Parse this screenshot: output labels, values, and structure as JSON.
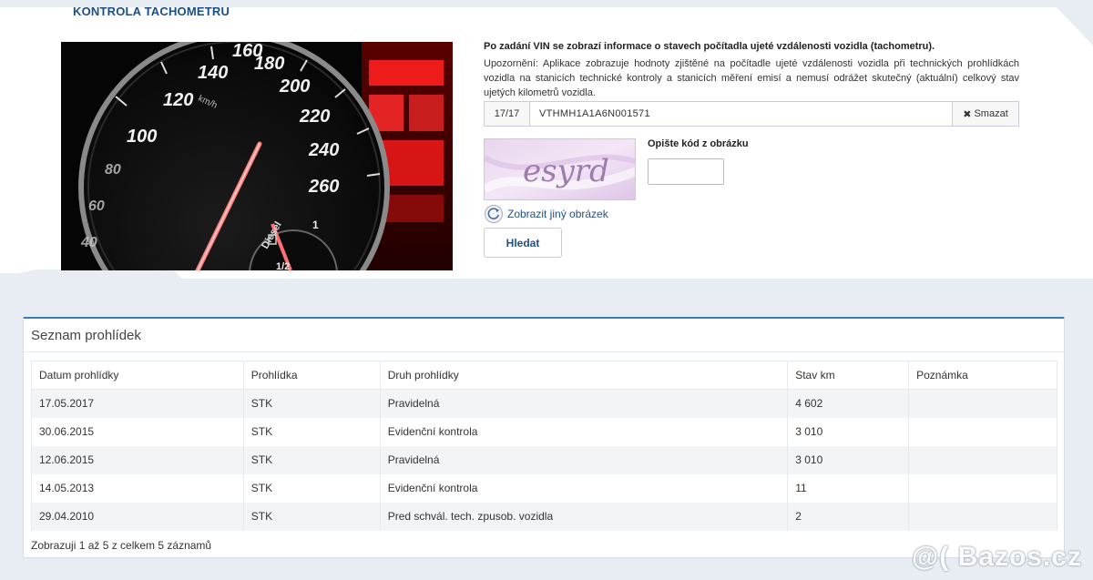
{
  "header": {
    "title": "KONTROLA TACHOMETRU"
  },
  "hero": {
    "speed_labels": [
      "100",
      "120",
      "140",
      "160",
      "180",
      "200",
      "220",
      "240",
      "260"
    ],
    "low_labels": [
      "80",
      "60",
      "40"
    ],
    "unit": "km/h",
    "fuel_label": "Diesel",
    "fuel_marks": [
      "1",
      "1/2"
    ]
  },
  "info": {
    "heading": "Po zadání VIN se zobrazí informace o stavech počítadla ujeté vzdálenosti vozidla (tachometru).",
    "warning": "Upozornění: Aplikace zobrazuje hodnoty zjištěné na počítadle ujeté vzdálenosti vozidla při technických prohlídkách vozidla na stanicích technické kontroly a stanicích měření emisí a nemusí odrážet skutečný (aktuální) celkový stav ujetých kilometrů vozidla."
  },
  "vin": {
    "count": "17/17",
    "value": "VTHMH1A1A6N001571",
    "clear_label": "Smazat"
  },
  "captcha": {
    "code_text": "esyrd",
    "label": "Opište kód z obrázku",
    "input_value": "",
    "refresh_label": "Zobrazit jiný obrázek"
  },
  "search_button": "Hledat",
  "inspections": {
    "title": "Seznam prohlídek",
    "columns": [
      "Datum prohlídky",
      "Prohlídka",
      "Druh prohlídky",
      "Stav km",
      "Poznámka"
    ],
    "rows": [
      [
        "17.05.2017",
        "STK",
        "Pravidelná",
        "4 602",
        ""
      ],
      [
        "30.06.2015",
        "STK",
        "Evidenční kontrola",
        "3 010",
        ""
      ],
      [
        "12.06.2015",
        "STK",
        "Pravidelná",
        "3 010",
        ""
      ],
      [
        "14.05.2013",
        "STK",
        "Evidenční kontrola",
        "11",
        ""
      ],
      [
        "29.04.2010",
        "STK",
        "Pred schvál. tech. zpusob. vozidla",
        "2",
        ""
      ]
    ],
    "footer": "Zobrazuji 1 až 5 z celkem 5 záznamů"
  },
  "watermark": "@( Bazos.cz",
  "colors": {
    "title": "#1a4e86",
    "accent": "#3a7bbf",
    "row_alt": "#f2f4f6",
    "gauge_red": "#ff2a2a"
  }
}
